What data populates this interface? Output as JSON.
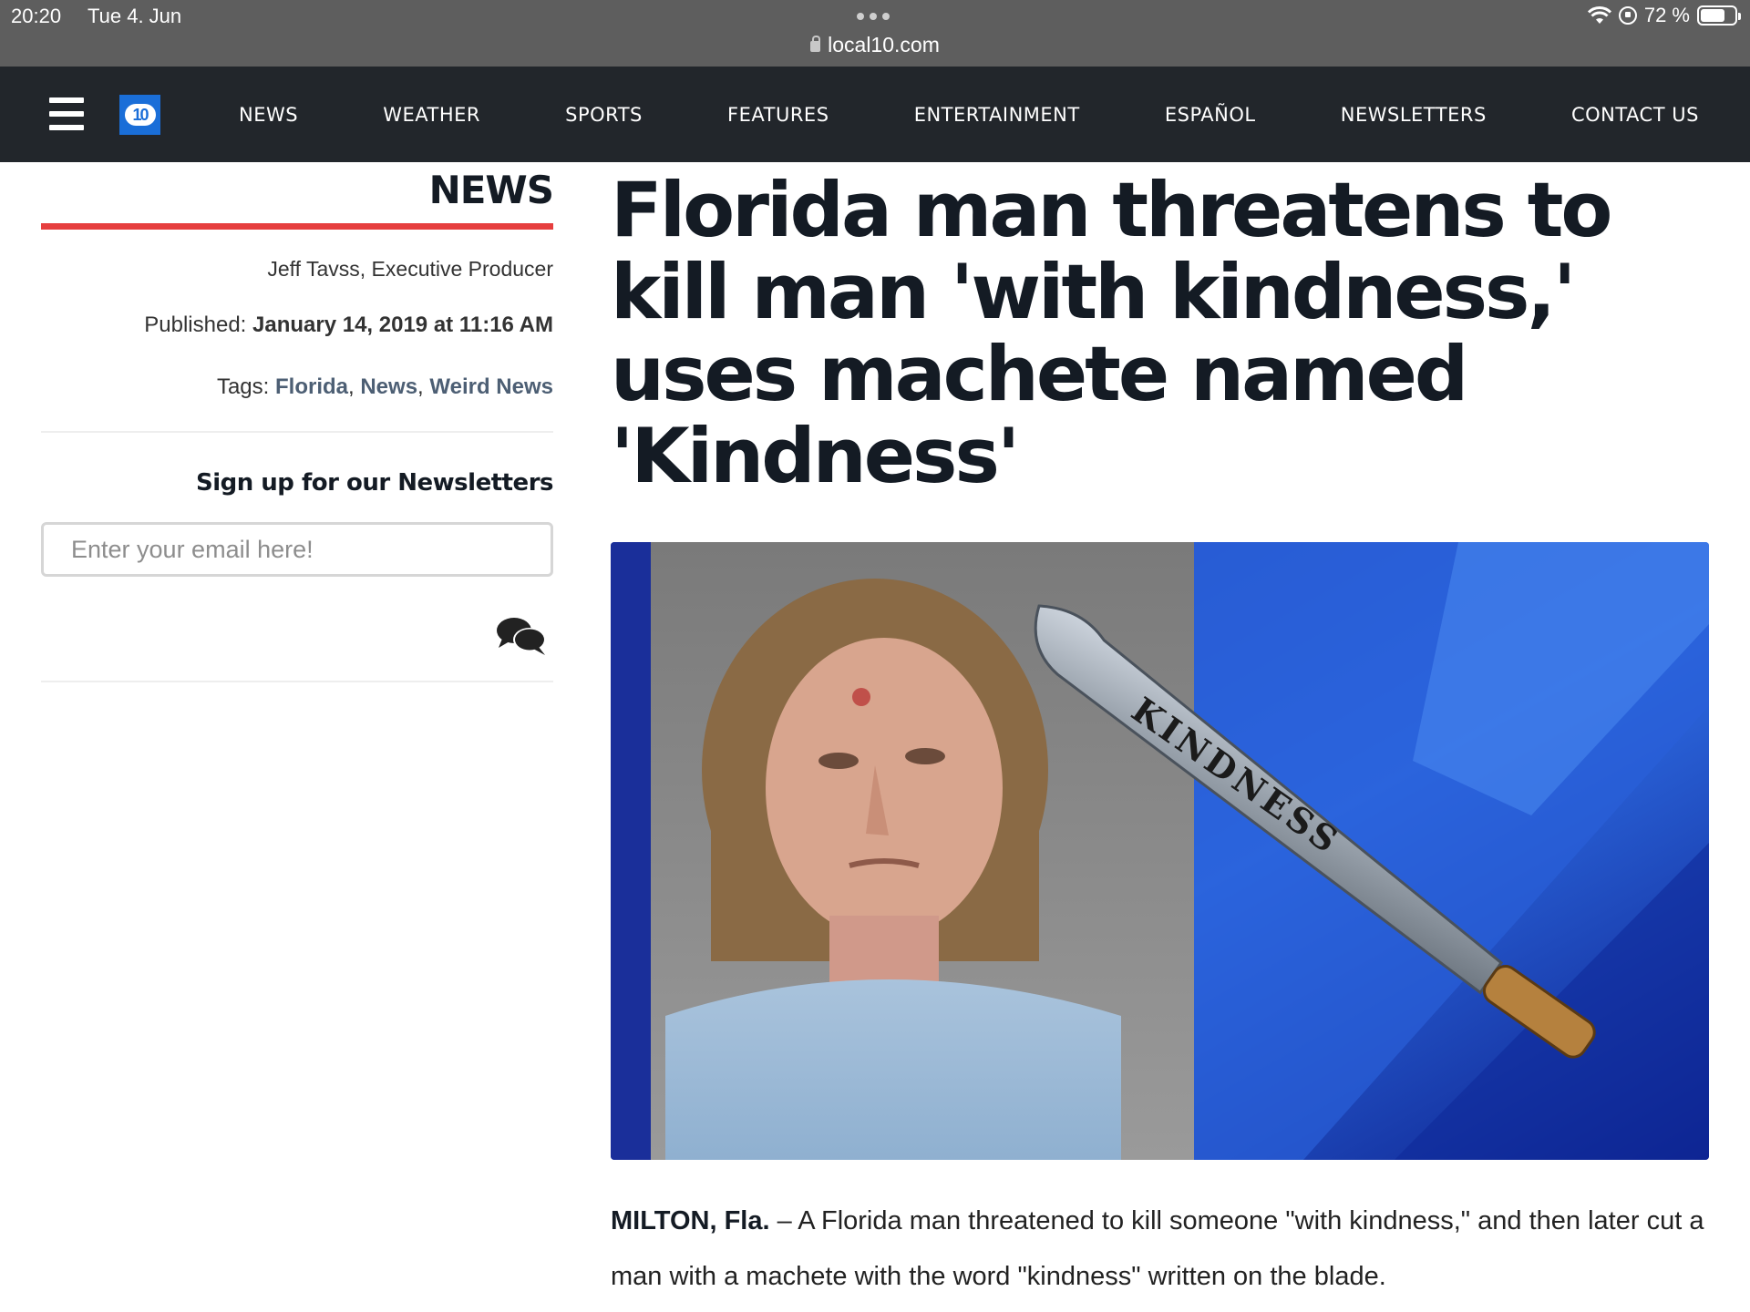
{
  "status_bar": {
    "time": "20:20",
    "date": "Tue 4. Jun",
    "url": "local10.com",
    "battery": "72 %",
    "battery_level": 0.72
  },
  "nav": {
    "logo_text": "10",
    "items": [
      "NEWS",
      "WEATHER",
      "SPORTS",
      "FEATURES",
      "ENTERTAINMENT",
      "ESPAÑOL",
      "NEWSLETTERS",
      "CONTACT US"
    ]
  },
  "sidebar": {
    "section": "NEWS",
    "author": "Jeff Tavss, Executive Producer",
    "published_label": "Published:",
    "published_value": "January 14, 2019 at 11:16 AM",
    "tags_label": "Tags:",
    "tags": [
      "Florida",
      "News",
      "Weird News"
    ],
    "tag_sep": ", ",
    "newsletter_title": "Sign up for our Newsletters",
    "email_placeholder": "Enter your email here!"
  },
  "article": {
    "headline": "Florida man threatens to kill man 'with kindness,' uses machete named 'Kindness'",
    "image_caption_text": "KINDNESS",
    "dateline": "MILTON, Fla.",
    "lede": " – A Florida man threatened to kill someone \"with kindness,\" and then later cut a man with a machete with the word \"kindness\" written on the blade."
  },
  "colors": {
    "nav_bg": "#22262b",
    "status_bg": "#5e5e5e",
    "accent_red": "#e63e3e",
    "logo_blue": "#1a6ed8",
    "tag_link": "#4d5f74",
    "headline": "#141b24"
  },
  "icons": {
    "menu": "hamburger-icon",
    "comments": "comment-bubbles-icon",
    "lock": "lock-icon",
    "wifi": "wifi-icon",
    "battery": "battery-icon"
  }
}
